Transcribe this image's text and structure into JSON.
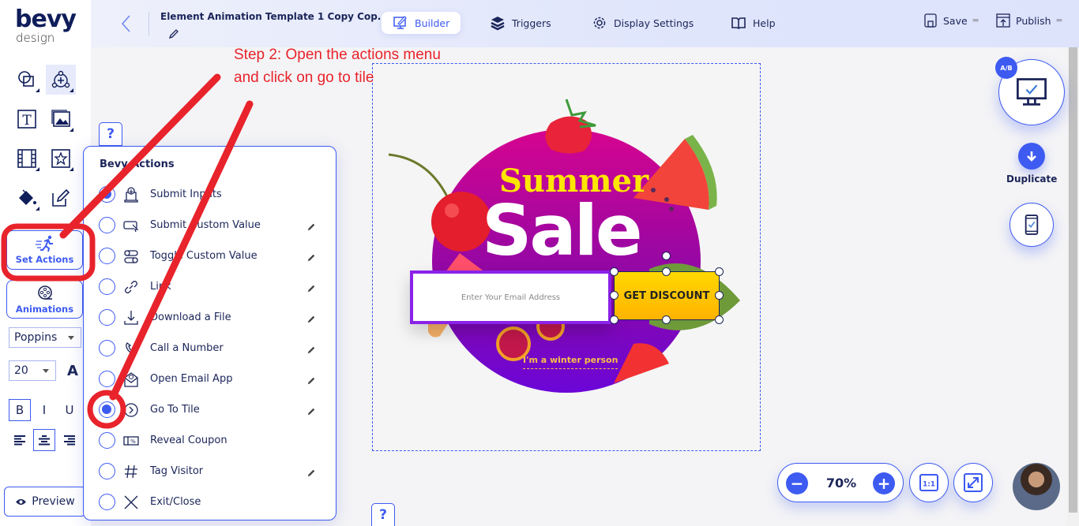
{
  "app": {
    "logo_main": "bevy",
    "logo_sub": "design",
    "doc_title": "Element Animation Template 1 Copy Cop..."
  },
  "nav": {
    "builder": "Builder",
    "triggers": "Triggers",
    "display_settings": "Display Settings",
    "help": "Help",
    "save": "Save",
    "publish": "Publish"
  },
  "sidebar": {
    "set_actions": "Set Actions",
    "animations": "Animations",
    "font_family": "Poppins",
    "font_size": "20",
    "font_color_glyph": "A",
    "bold": "B",
    "italic": "I",
    "underline": "U",
    "preview": "Preview"
  },
  "help_glyph": "?",
  "actions_menu": {
    "title": "Bevy Actions",
    "items": [
      {
        "label": "Submit Inputs",
        "icon": "submit-inputs-icon",
        "selected": true,
        "editable": false
      },
      {
        "label": "Submit Custom Value",
        "icon": "cursor-box-icon",
        "selected": false,
        "editable": true
      },
      {
        "label": "Toggle Custom Value",
        "icon": "toggle-icon",
        "selected": false,
        "editable": true
      },
      {
        "label": "Link",
        "icon": "link-icon",
        "selected": false,
        "editable": true
      },
      {
        "label": "Download a File",
        "icon": "download-icon",
        "selected": false,
        "editable": true
      },
      {
        "label": "Call a Number",
        "icon": "phone-icon",
        "selected": false,
        "editable": true
      },
      {
        "label": "Open Email App",
        "icon": "email-icon",
        "selected": false,
        "editable": true
      },
      {
        "label": "Go To Tile",
        "icon": "go-to-tile-icon",
        "selected": true,
        "editable": true
      },
      {
        "label": "Reveal Coupon",
        "icon": "coupon-icon",
        "selected": false,
        "editable": false
      },
      {
        "label": "Tag Visitor",
        "icon": "hash-icon",
        "selected": false,
        "editable": true
      },
      {
        "label": "Exit/Close",
        "icon": "close-icon",
        "selected": false,
        "editable": false
      }
    ]
  },
  "annotation": {
    "line1": "Step 2: Open the actions menu",
    "line2": "and click on go to tile",
    "color": "#e8232b"
  },
  "canvas": {
    "headline_1": "Summer",
    "headline_2": "Sale",
    "email_placeholder": "Enter Your Email Address",
    "cta": "GET DISCOUNT",
    "decline_link": "I'm a winter person"
  },
  "right_panel": {
    "ab_badge": "A/B",
    "duplicate": "Duplicate"
  },
  "zoom": {
    "value": "70%",
    "minus": "−",
    "plus": "+",
    "one_to_one": "1:1"
  },
  "colors": {
    "accent": "#3d5af1",
    "navy": "#1b2559",
    "cta_yellow": "#ffc800",
    "input_border": "#8a22e8"
  }
}
